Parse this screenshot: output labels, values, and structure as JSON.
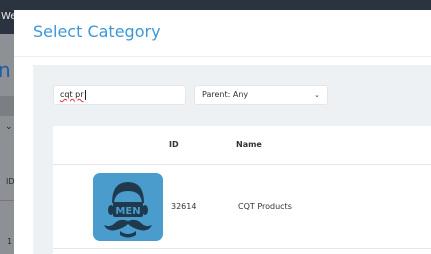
{
  "background": {
    "topbar_text": "We",
    "big_letter": "n",
    "col_label": "ID",
    "row_value": "1"
  },
  "modal": {
    "title": "Select Category",
    "search": {
      "value": "cqt pr"
    },
    "parent_filter": {
      "label": "Parent: Any"
    },
    "table": {
      "headers": {
        "id": "ID",
        "name": "Name"
      },
      "rows": [
        {
          "thumbnail_text": "MEN",
          "id": "32614",
          "name": "CQT Products"
        }
      ]
    }
  },
  "colors": {
    "title": "#3d97d6",
    "thumbnail_bg": "#4a9ccd",
    "panel_bg": "#eef1f4"
  }
}
